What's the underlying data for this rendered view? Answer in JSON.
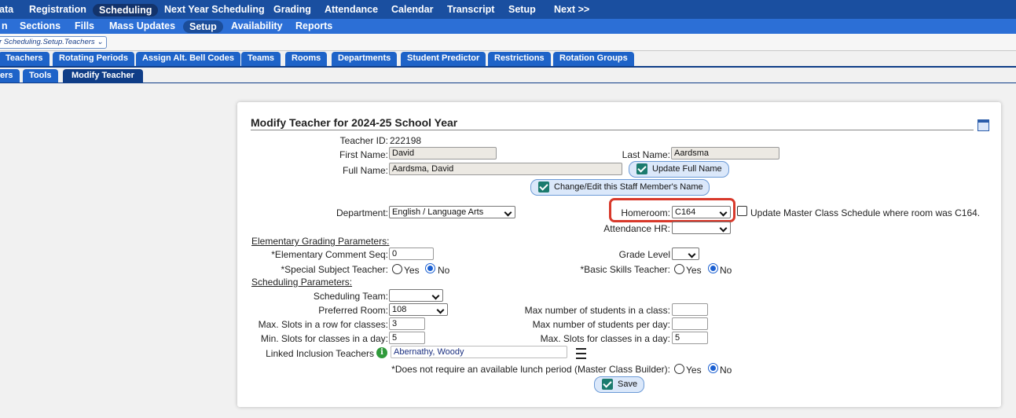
{
  "nav_main": [
    "ata",
    "Registration",
    "Scheduling",
    "Next Year Scheduling",
    "Grading",
    "Attendance",
    "Calendar",
    "Transcript",
    "Setup",
    "Next >>"
  ],
  "nav_sub": [
    "n",
    "Sections",
    "Fills",
    "Mass Updates",
    "Setup",
    "Availability",
    "Reports"
  ],
  "breadcrumb": "r Scheduling.Setup.Teachers",
  "tabs": [
    "Teachers",
    "Rotating Periods",
    "Assign Alt. Bell Codes",
    "Teams",
    "Rooms",
    "Departments",
    "Student Predictor",
    "Restrictions",
    "Rotation Groups"
  ],
  "subtabs": [
    "ers",
    "Tools",
    "Modify Teacher"
  ],
  "form": {
    "title": "Modify Teacher for 2024-25 School Year",
    "teacher_id_label": "Teacher ID:",
    "teacher_id": "222198",
    "first_name_label": "First Name:",
    "first_name": "David",
    "last_name_label": "Last Name:",
    "last_name": "Aardsma",
    "full_name_label": "Full Name:",
    "full_name": "Aardsma, David",
    "update_full_name_btn": "Update Full Name",
    "change_name_btn": "Change/Edit this Staff Member's Name",
    "department_label": "Department:",
    "department": "English / Language Arts",
    "homeroom_label": "Homeroom:",
    "homeroom": "C164",
    "update_master_label": "Update Master Class Schedule where room was C164.",
    "attendance_hr_label": "Attendance HR:",
    "attendance_hr": "",
    "elem_params_heading": "Elementary Grading Parameters:",
    "elem_comment_label": "*Elementary Comment Seq:",
    "elem_comment": "0",
    "grade_level_label": "Grade Level",
    "special_subject_label": "*Special Subject Teacher:",
    "basic_skills_label": "*Basic Skills Teacher:",
    "yes": "Yes",
    "no": "No",
    "sched_params_heading": "Scheduling Parameters:",
    "sched_team_label": "Scheduling Team:",
    "preferred_room_label": "Preferred Room:",
    "preferred_room": "108",
    "max_students_class_label": "Max number of students in a class:",
    "max_slots_row_label": "Max. Slots in a row for classes:",
    "max_slots_row": "3",
    "max_students_day_label": "Max number of students per day:",
    "min_slots_day_label": "Min. Slots for classes in a day:",
    "min_slots_day": "5",
    "max_slots_day_label": "Max. Slots for classes in a day:",
    "max_slots_day": "5",
    "linked_inclusion_label": "Linked Inclusion Teachers",
    "linked_inclusion": "Abernathy, Woody",
    "lunch_label": "*Does not require an available lunch period (Master Class Builder):",
    "save_btn": "Save"
  },
  "colors": {
    "nav_dark": "#1a4fa0",
    "nav_light": "#2c6fd6",
    "tab_blue": "#1e63c8",
    "highlight": "#d8392b",
    "check_teal": "#1b7b6e"
  }
}
